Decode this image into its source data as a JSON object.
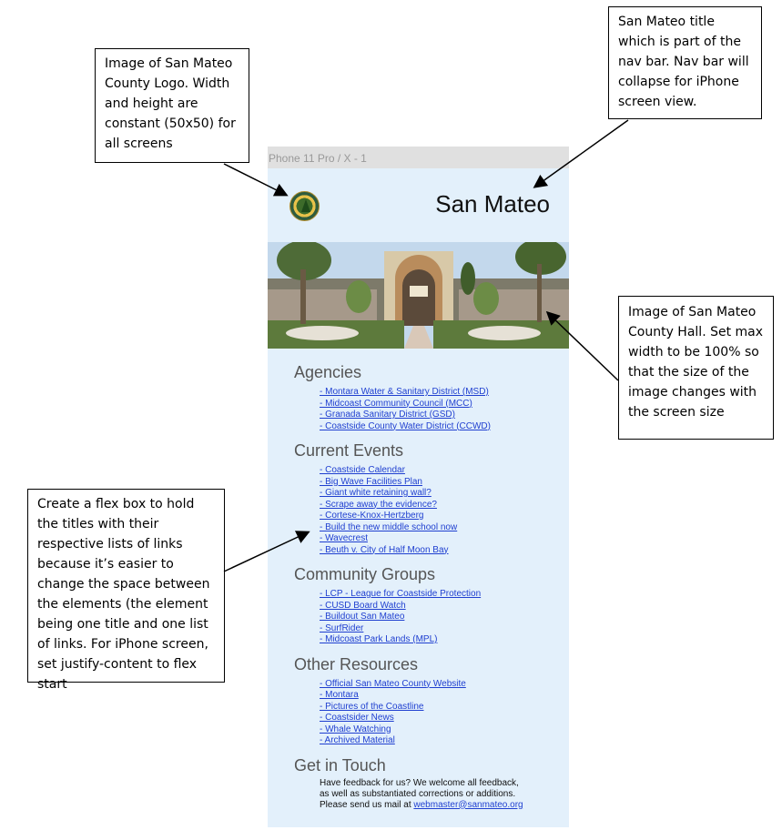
{
  "annotations": {
    "logo_note": "Image of San Mateo County Logo. Width and height are constant (50x50) for all screens",
    "title_note": "San Mateo title which is part of the nav bar. Nav bar will collapse for iPhone screen view.",
    "hall_note": "Image of San Mateo County Hall. Set max width to be 100% so that the size of the image changes with the screen size",
    "flex_note": "Create a flex box to hold the titles with their respective lists of links because it’s easier to change the space between the elements (the element being one title and one list of links. For iPhone screen, set justify-content to flex start"
  },
  "phone": {
    "frame_label": "Phone 11 Pro / X - 1",
    "site_title": "San Mateo",
    "logo_icon": "san-mateo-county-seal",
    "hero_image": "san-mateo-county-hall-photo"
  },
  "sections": {
    "agencies": {
      "title": "Agencies",
      "links": [
        "- Montara Water & Sanitary District (MSD)",
        "- Midcoast Community Council (MCC)",
        "- Granada Sanitary District (GSD)",
        "- Coastside County Water District (CCWD)"
      ]
    },
    "events": {
      "title": "Current Events",
      "links": [
        "- Coastside Calendar",
        "- Big Wave Facilities Plan",
        "- Giant white retaining wall?",
        "- Scrape away the evidence?",
        "- Cortese-Knox-Hertzberg",
        "- Build the new middle school now",
        "- Wavecrest",
        "- Beuth v. City of Half Moon Bay"
      ]
    },
    "groups": {
      "title": "Community Groups",
      "links": [
        "- LCP - League for Coastside Protection",
        "- CUSD Board Watch",
        "- Buildout San Mateo",
        "- SurfRider",
        "- Midcoast Park Lands (MPL)"
      ]
    },
    "resources": {
      "title": "Other Resources",
      "links": [
        "- Official San Mateo County Website",
        "- Montara",
        "- Pictures of the Coastline",
        "- Coastsider News",
        "- Whale Watching",
        "- Archived Material"
      ]
    },
    "contact": {
      "title": "Get in Touch",
      "line1": "Have feedback for us? We welcome all feedback,",
      "line2": "as well as substantiated corrections or additions.",
      "line3": "Please send us mail at ",
      "email": "webmaster@sanmateo.org"
    }
  },
  "colors": {
    "phone_bg": "#e3f0fb",
    "link": "#1f3fd0",
    "heading": "#555555"
  }
}
